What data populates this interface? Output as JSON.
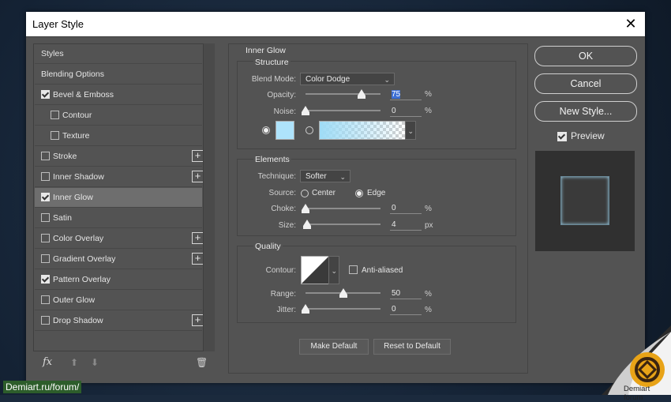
{
  "window": {
    "title": "Layer Style",
    "close_glyph": "✕"
  },
  "styles_list": [
    {
      "label": "Styles",
      "checkbox": false,
      "checked": false,
      "plus": false,
      "indent": 0,
      "selected": false
    },
    {
      "label": "Blending Options",
      "checkbox": false,
      "checked": false,
      "plus": false,
      "indent": 0,
      "selected": false
    },
    {
      "label": "Bevel & Emboss",
      "checkbox": true,
      "checked": true,
      "plus": false,
      "indent": 0,
      "selected": false
    },
    {
      "label": "Contour",
      "checkbox": true,
      "checked": false,
      "plus": false,
      "indent": 1,
      "selected": false
    },
    {
      "label": "Texture",
      "checkbox": true,
      "checked": false,
      "plus": false,
      "indent": 1,
      "selected": false
    },
    {
      "label": "Stroke",
      "checkbox": true,
      "checked": false,
      "plus": true,
      "indent": 0,
      "selected": false
    },
    {
      "label": "Inner Shadow",
      "checkbox": true,
      "checked": false,
      "plus": true,
      "indent": 0,
      "selected": false
    },
    {
      "label": "Inner Glow",
      "checkbox": true,
      "checked": true,
      "plus": false,
      "indent": 0,
      "selected": true
    },
    {
      "label": "Satin",
      "checkbox": true,
      "checked": false,
      "plus": false,
      "indent": 0,
      "selected": false
    },
    {
      "label": "Color Overlay",
      "checkbox": true,
      "checked": false,
      "plus": true,
      "indent": 0,
      "selected": false
    },
    {
      "label": "Gradient Overlay",
      "checkbox": true,
      "checked": false,
      "plus": true,
      "indent": 0,
      "selected": false
    },
    {
      "label": "Pattern Overlay",
      "checkbox": true,
      "checked": true,
      "plus": false,
      "indent": 0,
      "selected": false
    },
    {
      "label": "Outer Glow",
      "checkbox": true,
      "checked": false,
      "plus": false,
      "indent": 0,
      "selected": false
    },
    {
      "label": "Drop Shadow",
      "checkbox": true,
      "checked": false,
      "plus": true,
      "indent": 0,
      "selected": false
    }
  ],
  "footer": {
    "fx_label": "fx",
    "up_glyph": "⬆",
    "down_glyph": "⬇",
    "trash_glyph": "🗑"
  },
  "inner_glow": {
    "section_title": "Inner Glow",
    "structure": {
      "title": "Structure",
      "blend_mode_label": "Blend Mode:",
      "blend_mode_value": "Color Dodge",
      "opacity_label": "Opacity:",
      "opacity_value": "75",
      "opacity_level": 75,
      "noise_label": "Noise:",
      "noise_value": "0",
      "noise_level": 0,
      "unit_percent": "%",
      "solid_color": "#aee3fb",
      "gradient_from": "#9fdcf6"
    },
    "elements": {
      "title": "Elements",
      "technique_label": "Technique:",
      "technique_value": "Softer",
      "source_label": "Source:",
      "source_center": "Center",
      "source_edge": "Edge",
      "source_selected": "Edge",
      "choke_label": "Choke:",
      "choke_value": "0",
      "choke_level": 0,
      "size_label": "Size:",
      "size_value": "4",
      "size_level": 2,
      "unit_percent": "%",
      "unit_px": "px"
    },
    "quality": {
      "title": "Quality",
      "contour_label": "Contour:",
      "anti_aliased_label": "Anti-aliased",
      "range_label": "Range:",
      "range_value": "50",
      "range_level": 50,
      "jitter_label": "Jitter:",
      "jitter_value": "0",
      "jitter_level": 0,
      "unit_percent": "%"
    },
    "make_default_label": "Make Default",
    "reset_default_label": "Reset to Default"
  },
  "actions": {
    "ok_label": "OK",
    "cancel_label": "Cancel",
    "new_style_label": "New Style...",
    "preview_label": "Preview",
    "preview_checked": true
  },
  "watermark": {
    "site": "Demiart.ru/forum/",
    "forum_label": "Demiart forum"
  },
  "colors": {
    "panel": "#535353",
    "selected_row": "#6e6e6e",
    "highlight": "#3d6fd4"
  }
}
